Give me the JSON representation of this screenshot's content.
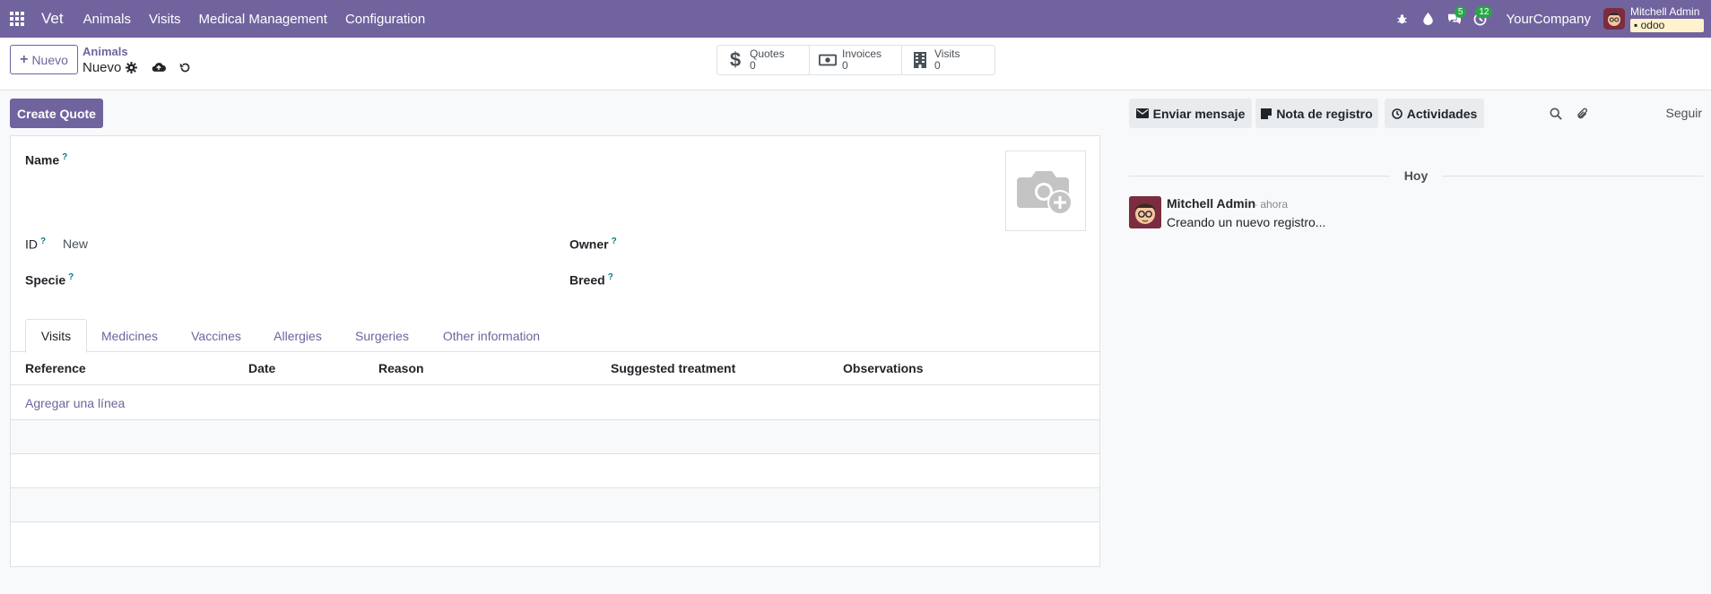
{
  "navbar": {
    "brand": "Vet",
    "menu": [
      "Animals",
      "Visits",
      "Medical Management",
      "Configuration"
    ],
    "messages_badge": "5",
    "activities_badge": "12",
    "company": "YourCompany",
    "user_name": "Mitchell Admin",
    "database": "odoo",
    "accent_color": "#71639e"
  },
  "control_panel": {
    "new_button": "Nuevo",
    "breadcrumb_parent": "Animals",
    "breadcrumb_current": "Nuevo",
    "stats": [
      {
        "label": "Quotes",
        "value": "0",
        "icon": "dollar-icon"
      },
      {
        "label": "Invoices",
        "value": "0",
        "icon": "money-icon"
      },
      {
        "label": "Visits",
        "value": "0",
        "icon": "building-icon"
      }
    ]
  },
  "form": {
    "create_quote_button": "Create Quote",
    "fields": {
      "name_label": "Name",
      "id_label": "ID",
      "id_value": "New",
      "owner_label": "Owner",
      "specie_label": "Specie",
      "breed_label": "Breed",
      "help_mark": "?"
    },
    "tabs": [
      "Visits",
      "Medicines",
      "Vaccines",
      "Allergies",
      "Surgeries",
      "Other information"
    ],
    "active_tab": "Visits",
    "columns": [
      "Reference",
      "Date",
      "Reason",
      "Suggested treatment",
      "Observations"
    ],
    "add_line": "Agregar una línea"
  },
  "chatter": {
    "send_message": "Enviar mensaje",
    "log_note": "Nota de registro",
    "activities": "Actividades",
    "follow": "Seguir",
    "date_separator": "Hoy",
    "message": {
      "author": "Mitchell Admin",
      "time": "- ahora",
      "body": "Creando un nuevo registro..."
    }
  }
}
